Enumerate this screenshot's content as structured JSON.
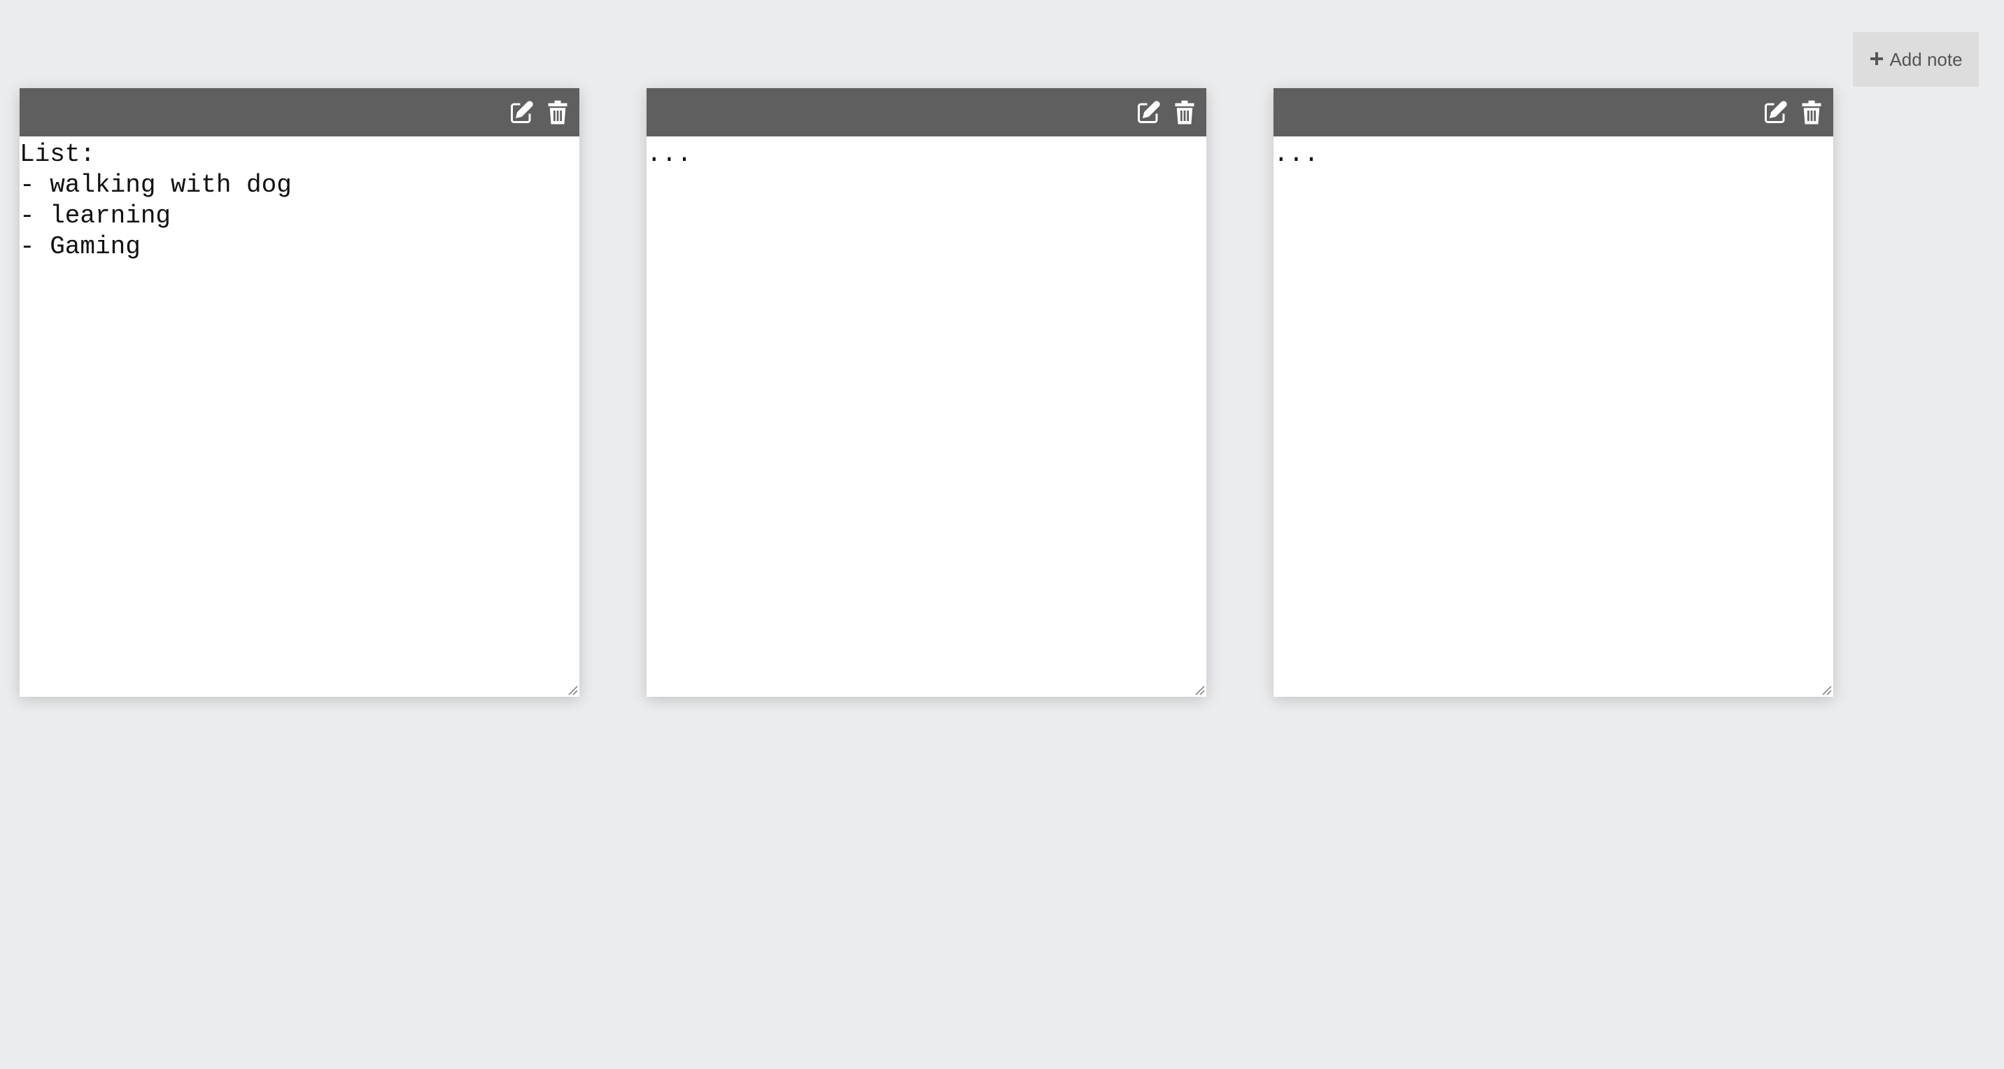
{
  "toolbar": {
    "add_note_label": "Add note",
    "add_icon": "plus-icon"
  },
  "notes": [
    {
      "content": "List:\n- walking with dog\n- learning\n- Gaming",
      "actions": [
        "edit-icon",
        "trash-icon"
      ]
    },
    {
      "content": "...",
      "actions": [
        "edit-icon",
        "trash-icon"
      ]
    },
    {
      "content": "...",
      "actions": [
        "edit-icon",
        "trash-icon"
      ]
    }
  ],
  "colors": {
    "background": "#eaecee",
    "toolbar": "#5f5f5f",
    "note": "#ffffff",
    "button": "#dcdddc"
  }
}
